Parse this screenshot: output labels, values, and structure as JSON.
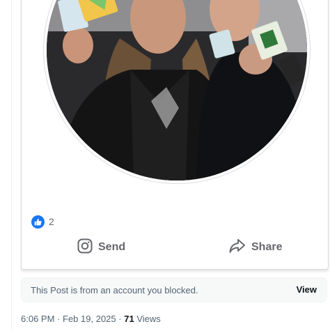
{
  "card": {
    "reaction_count": "2",
    "actions": [
      {
        "label": "Send",
        "icon": "instagram-icon"
      },
      {
        "label": "Share",
        "icon": "share-arrow-icon"
      }
    ]
  },
  "notice": {
    "text": "This Post is from an account you blocked.",
    "view_label": "View"
  },
  "meta": {
    "time": "6:06 PM",
    "date": "Feb 19, 2025",
    "separator": "·",
    "views_count": "71",
    "views_label": "Views"
  },
  "colors": {
    "like_blue": "#1877f2",
    "muted_text": "#536471",
    "action_text": "#65676b"
  }
}
